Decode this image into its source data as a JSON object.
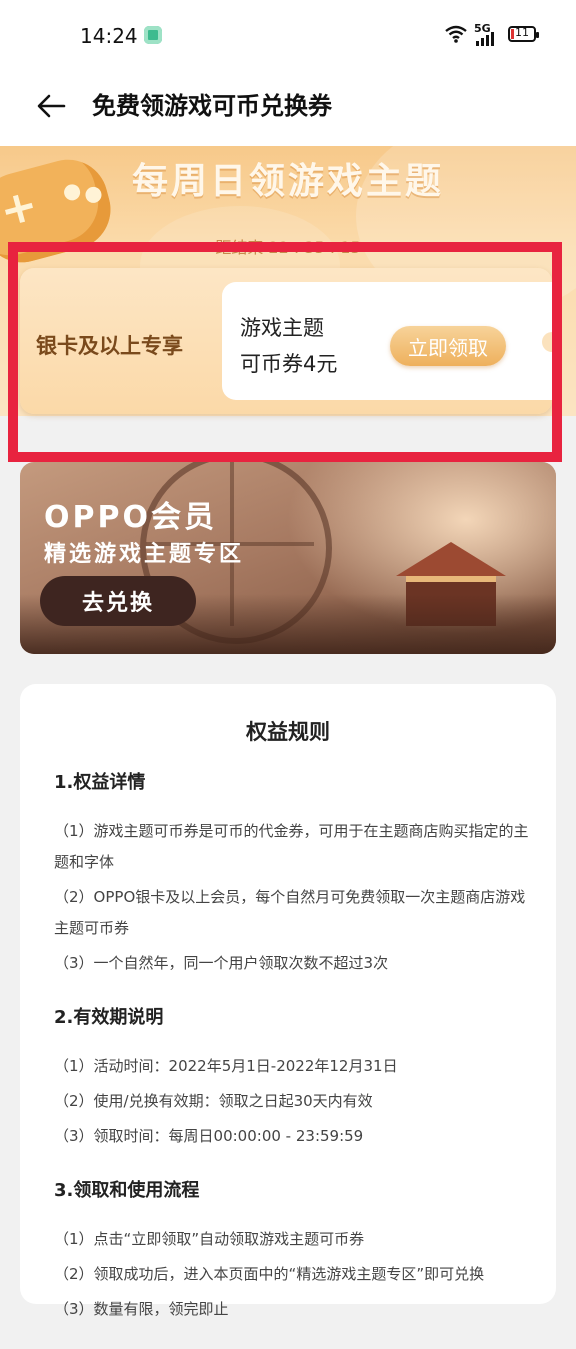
{
  "status_bar": {
    "time": "14:24",
    "network": "5G",
    "battery": "11"
  },
  "header": {
    "title": "免费领游戏可币兑换券",
    "back_icon": "arrow-left-icon"
  },
  "banner": {
    "title": "每周日领游戏主题",
    "countdown": "距结束 22 : 35 : 15"
  },
  "coupon": {
    "tier_label": "银卡及以上专享",
    "line1": "游戏主题",
    "line2": "可币券4元",
    "claim_button": "立即领取"
  },
  "promo": {
    "title": "OPPO会员",
    "subtitle": "精选游戏主题专区",
    "button": "去兑换"
  },
  "rules": {
    "title": "权益规则",
    "sections": [
      {
        "heading": "1.权益详情",
        "items": [
          "（1）游戏主题可币券是可币的代金券，可用于在主题商店购买指定的主题和字体",
          "（2）OPPO银卡及以上会员，每个自然月可免费领取一次主题商店游戏主题可币券",
          "（3）一个自然年，同一个用户领取次数不超过3次"
        ]
      },
      {
        "heading": "2.有效期说明",
        "items": [
          "（1）活动时间：2022年5月1日-2022年12月31日",
          "（2）使用/兑换有效期：领取之日起30天内有效",
          "（3）领取时间：每周日00:00:00 - 23:59:59"
        ]
      },
      {
        "heading": "3.领取和使用流程",
        "items": [
          "（1）点击“立即领取”自动领取游戏主题可币券",
          "（2）领取成功后，进入本页面中的“精选游戏主题专区”即可兑换",
          "（3）数量有限，领完即止"
        ]
      }
    ]
  },
  "colors": {
    "highlight_frame": "#e8233f",
    "claim_button": "#eeb05c",
    "promo_button": "#3e2520"
  }
}
